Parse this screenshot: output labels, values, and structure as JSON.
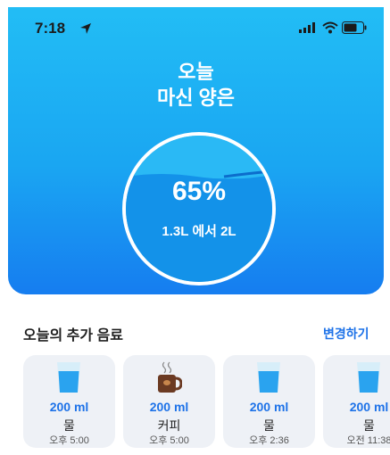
{
  "status_bar": {
    "time": "7:18"
  },
  "header": {
    "title_line1": "오늘",
    "title_line2": "마신 양은"
  },
  "progress": {
    "percent_label": "65%",
    "percent_value": 0.65,
    "amount_label": "1.3L 에서 2L"
  },
  "drinks": {
    "section_title": "오늘의 추가 음료",
    "edit_label": "변경하기",
    "items": [
      {
        "amount": "200 ml",
        "name": "물",
        "time": "오후 5:00",
        "icon": "water-glass-icon"
      },
      {
        "amount": "200 ml",
        "name": "커피",
        "time": "오후 5:00",
        "icon": "coffee-cup-icon"
      },
      {
        "amount": "200 ml",
        "name": "물",
        "time": "오후 2:36",
        "icon": "water-glass-icon"
      },
      {
        "amount": "200 ml",
        "name": "물",
        "time": "오전 11:38",
        "icon": "water-glass-icon"
      }
    ]
  },
  "colors": {
    "accent": "#1d72e8",
    "hero_top": "#22bdf5",
    "hero_bottom": "#167df0",
    "card_bg": "#eef1f6"
  }
}
